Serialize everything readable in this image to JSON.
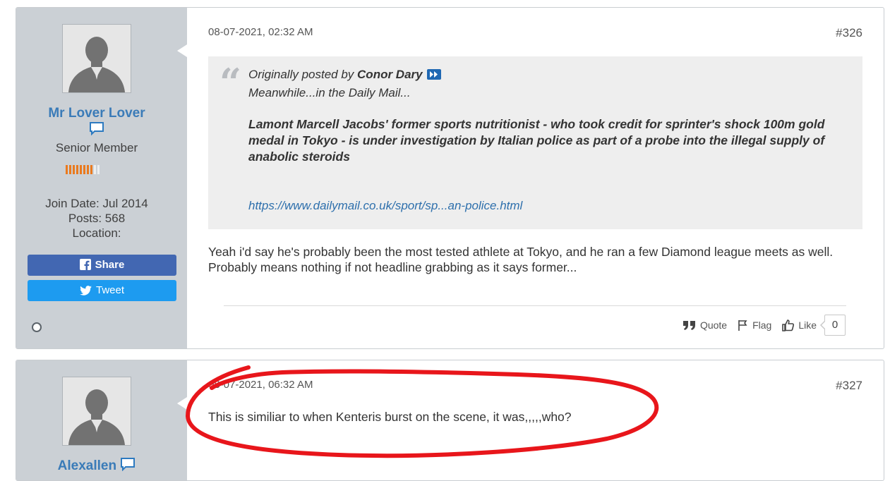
{
  "posts": [
    {
      "username": "Mr Lover Lover",
      "user_title": "Senior Member",
      "reputation": {
        "filled": 8,
        "total": 10
      },
      "join_date": "Join Date: Jul 2014",
      "posts_count": "Posts: 568",
      "location": "Location:",
      "share_label": "Share",
      "tweet_label": "Tweet",
      "online_status": "offline",
      "date": "08-07-2021, 02:32 AM",
      "post_number": "#326",
      "quote": {
        "prefix": "Originally posted by ",
        "author": "Conor Dary",
        "line1": "Meanwhile...in the Daily Mail...",
        "headline": "Lamont Marcell Jacobs' former sports nutritionist - who took credit for sprinter's shock 100m gold medal in Tokyo - is under investigation by Italian police as part of a probe into the illegal supply of anabolic steroids",
        "link": "https://www.dailymail.co.uk/sport/sp...an-police.html"
      },
      "text": "Yeah i'd say he's probably been the most tested athlete at Tokyo, and he ran a few Diamond league meets as well. Probably means nothing if not headline grabbing as it says former...",
      "actions": {
        "quote": "Quote",
        "flag": "Flag",
        "like": "Like",
        "like_count": "0"
      }
    },
    {
      "username": "Alexallen",
      "date": "08-07-2021, 06:32 AM",
      "post_number": "#327",
      "text": "This is similiar to when Kenteris burst on the scene, it was,,,,,who?"
    }
  ],
  "colors": {
    "username": "#3a7bb8",
    "sidebar": "#cbd0d5",
    "reputation": "#ea7a1e",
    "share": "#4267b2",
    "tweet": "#1d9bf0",
    "annotation": "#e8161b"
  }
}
